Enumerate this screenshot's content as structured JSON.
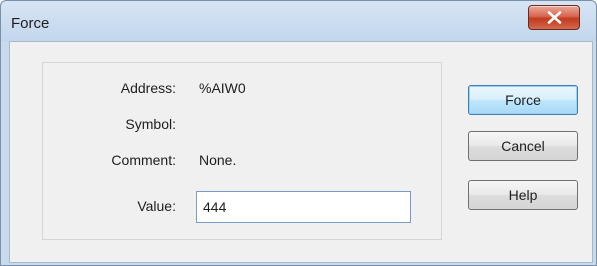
{
  "window": {
    "title": "Force",
    "close_symbol": "close-icon"
  },
  "fields": {
    "address_label": "Address:",
    "address_value": "%AIW0",
    "symbol_label": "Symbol:",
    "symbol_value": "",
    "comment_label": "Comment:",
    "comment_value": "None.",
    "value_label": "Value:",
    "value_input": "444"
  },
  "buttons": {
    "force": "Force",
    "cancel": "Cancel",
    "help": "Help"
  },
  "colors": {
    "title_bar": "#c3d6ec",
    "close_button": "#c23a1f",
    "default_button_border": "#3c7fb1"
  }
}
